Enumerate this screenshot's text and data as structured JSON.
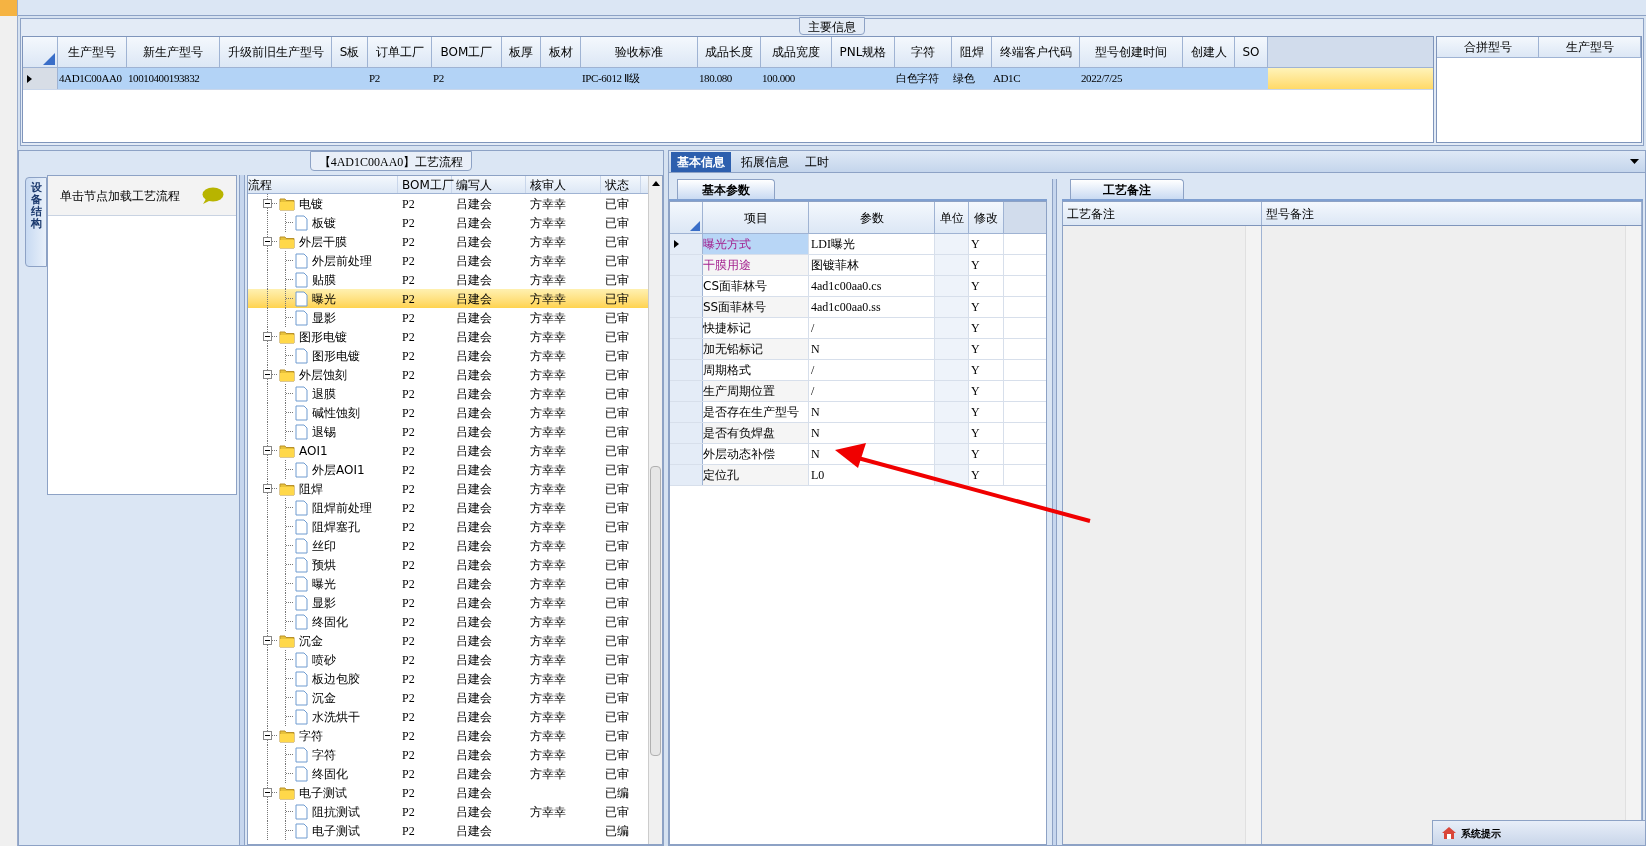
{
  "main_info": {
    "title": "主要信息",
    "columns": [
      "生产型号",
      "新生产型号",
      "升级前旧生产型号",
      "S板",
      "订单工厂",
      "BOM工厂",
      "板厚",
      "板材",
      "验收标准",
      "成品长度",
      "成品宽度",
      "PNL规格",
      "字符",
      "阻焊",
      "终端客户代码",
      "型号创建时间",
      "创建人",
      "SO"
    ],
    "rows": [
      {
        "selected": true,
        "cells": [
          "4AD1C00AA0",
          "10010400193832",
          null,
          null,
          "P2",
          "P2",
          null,
          null,
          "IPC-6012 Ⅱ级",
          "180.080",
          "100.000",
          null,
          "白色字符",
          "绿色",
          "AD1C",
          "2022/7/25",
          null,
          null
        ]
      }
    ]
  },
  "merge_table": {
    "columns": [
      "合拼型号",
      "生产型号"
    ]
  },
  "process_panel": {
    "title": "【4AD1C00AA0】工艺流程",
    "side_tab": "设备结构",
    "hint": "单击节点加载工艺流程",
    "columns": [
      "流程",
      "BOM工厂",
      "编写人",
      "核审人",
      "状态"
    ],
    "tree": [
      {
        "name": "电镀",
        "factory": "P2",
        "writer": "吕建会",
        "reviewer": "方幸幸",
        "status": "已审",
        "selected": false,
        "children": [
          {
            "name": "板镀",
            "factory": "P2",
            "writer": "吕建会",
            "reviewer": "方幸幸",
            "status": "已审",
            "selected": false
          }
        ]
      },
      {
        "name": "外层干膜",
        "factory": "P2",
        "writer": "吕建会",
        "reviewer": "方幸幸",
        "status": "已审",
        "selected": false,
        "children": [
          {
            "name": "外层前处理",
            "factory": "P2",
            "writer": "吕建会",
            "reviewer": "方幸幸",
            "status": "已审",
            "selected": false
          },
          {
            "name": "贴膜",
            "factory": "P2",
            "writer": "吕建会",
            "reviewer": "方幸幸",
            "status": "已审",
            "selected": false
          },
          {
            "name": "曝光",
            "factory": "P2",
            "writer": "吕建会",
            "reviewer": "方幸幸",
            "status": "已审",
            "selected": true
          },
          {
            "name": "显影",
            "factory": "P2",
            "writer": "吕建会",
            "reviewer": "方幸幸",
            "status": "已审",
            "selected": false
          }
        ]
      },
      {
        "name": "图形电镀",
        "factory": "P2",
        "writer": "吕建会",
        "reviewer": "方幸幸",
        "status": "已审",
        "selected": false,
        "children": [
          {
            "name": "图形电镀",
            "factory": "P2",
            "writer": "吕建会",
            "reviewer": "方幸幸",
            "status": "已审",
            "selected": false
          }
        ]
      },
      {
        "name": "外层蚀刻",
        "factory": "P2",
        "writer": "吕建会",
        "reviewer": "方幸幸",
        "status": "已审",
        "selected": false,
        "children": [
          {
            "name": "退膜",
            "factory": "P2",
            "writer": "吕建会",
            "reviewer": "方幸幸",
            "status": "已审",
            "selected": false
          },
          {
            "name": "碱性蚀刻",
            "factory": "P2",
            "writer": "吕建会",
            "reviewer": "方幸幸",
            "status": "已审",
            "selected": false
          },
          {
            "name": "退锡",
            "factory": "P2",
            "writer": "吕建会",
            "reviewer": "方幸幸",
            "status": "已审",
            "selected": false
          }
        ]
      },
      {
        "name": "AOI1",
        "factory": "P2",
        "writer": "吕建会",
        "reviewer": "方幸幸",
        "status": "已审",
        "selected": false,
        "children": [
          {
            "name": "外层AOI1",
            "factory": "P2",
            "writer": "吕建会",
            "reviewer": "方幸幸",
            "status": "已审",
            "selected": false
          }
        ]
      },
      {
        "name": "阻焊",
        "factory": "P2",
        "writer": "吕建会",
        "reviewer": "方幸幸",
        "status": "已审",
        "selected": false,
        "children": [
          {
            "name": "阻焊前处理",
            "factory": "P2",
            "writer": "吕建会",
            "reviewer": "方幸幸",
            "status": "已审",
            "selected": false
          },
          {
            "name": "阻焊塞孔",
            "factory": "P2",
            "writer": "吕建会",
            "reviewer": "方幸幸",
            "status": "已审",
            "selected": false
          },
          {
            "name": "丝印",
            "factory": "P2",
            "writer": "吕建会",
            "reviewer": "方幸幸",
            "status": "已审",
            "selected": false
          },
          {
            "name": "预烘",
            "factory": "P2",
            "writer": "吕建会",
            "reviewer": "方幸幸",
            "status": "已审",
            "selected": false
          },
          {
            "name": "曝光",
            "factory": "P2",
            "writer": "吕建会",
            "reviewer": "方幸幸",
            "status": "已审",
            "selected": false
          },
          {
            "name": "显影",
            "factory": "P2",
            "writer": "吕建会",
            "reviewer": "方幸幸",
            "status": "已审",
            "selected": false
          },
          {
            "name": "终固化",
            "factory": "P2",
            "writer": "吕建会",
            "reviewer": "方幸幸",
            "status": "已审",
            "selected": false
          }
        ]
      },
      {
        "name": "沉金",
        "factory": "P2",
        "writer": "吕建会",
        "reviewer": "方幸幸",
        "status": "已审",
        "selected": false,
        "children": [
          {
            "name": "喷砂",
            "factory": "P2",
            "writer": "吕建会",
            "reviewer": "方幸幸",
            "status": "已审",
            "selected": false
          },
          {
            "name": "板边包胶",
            "factory": "P2",
            "writer": "吕建会",
            "reviewer": "方幸幸",
            "status": "已审",
            "selected": false
          },
          {
            "name": "沉金",
            "factory": "P2",
            "writer": "吕建会",
            "reviewer": "方幸幸",
            "status": "已审",
            "selected": false
          },
          {
            "name": "水洗烘干",
            "factory": "P2",
            "writer": "吕建会",
            "reviewer": "方幸幸",
            "status": "已审",
            "selected": false
          }
        ]
      },
      {
        "name": "字符",
        "factory": "P2",
        "writer": "吕建会",
        "reviewer": "方幸幸",
        "status": "已审",
        "selected": false,
        "children": [
          {
            "name": "字符",
            "factory": "P2",
            "writer": "吕建会",
            "reviewer": "方幸幸",
            "status": "已审",
            "selected": false
          },
          {
            "name": "终固化",
            "factory": "P2",
            "writer": "吕建会",
            "reviewer": "方幸幸",
            "status": "已审",
            "selected": false
          }
        ]
      },
      {
        "name": "电子测试",
        "factory": "P2",
        "writer": "吕建会",
        "status": "已编",
        "selected": false,
        "children": [
          {
            "name": "阻抗测试",
            "factory": "P2",
            "writer": "吕建会",
            "reviewer": "方幸幸",
            "status": "已审",
            "selected": false
          },
          {
            "name": "电子测试",
            "factory": "P2",
            "writer": "吕建会",
            "status": "已编",
            "selected": false
          }
        ]
      }
    ]
  },
  "detail_tabs": [
    {
      "label": "基本信息",
      "selected": true
    },
    {
      "label": "拓展信息",
      "selected": false
    },
    {
      "label": "工时",
      "selected": false
    }
  ],
  "params": {
    "tab": "基本参数",
    "columns": [
      "项目",
      "参数",
      "单位",
      "修改"
    ],
    "rows": [
      {
        "item": "曝光方式",
        "value": "LDI曝光",
        "modify": "Y",
        "highlighted": true,
        "selected": true
      },
      {
        "item": "干膜用途",
        "value": "图镀菲林",
        "modify": "Y",
        "highlighted": true,
        "selected": false
      },
      {
        "item": "CS面菲林号",
        "value": "4ad1c00aa0.cs",
        "modify": "Y",
        "highlighted": false,
        "selected": false
      },
      {
        "item": "SS面菲林号",
        "value": "4ad1c00aa0.ss",
        "modify": "Y",
        "highlighted": false,
        "selected": false
      },
      {
        "item": "快捷标记",
        "value": "/",
        "modify": "Y",
        "highlighted": false,
        "selected": false
      },
      {
        "item": "加无铅标记",
        "value": "N",
        "modify": "Y",
        "highlighted": false,
        "selected": false
      },
      {
        "item": "周期格式",
        "value": "/",
        "modify": "Y",
        "highlighted": false,
        "selected": false
      },
      {
        "item": "生产周期位置",
        "value": "/",
        "modify": "Y",
        "highlighted": false,
        "selected": false
      },
      {
        "item": "是否存在生产型号",
        "value": "N",
        "modify": "Y",
        "highlighted": false,
        "selected": false
      },
      {
        "item": "是否有负焊盘",
        "value": "N",
        "modify": "Y",
        "highlighted": false,
        "selected": false
      },
      {
        "item": "外层动态补偿",
        "value": "N",
        "modify": "Y",
        "highlighted": false,
        "selected": false
      },
      {
        "item": "定位孔",
        "value": "L0",
        "modify": "Y",
        "highlighted": false,
        "selected": false
      }
    ]
  },
  "notes": {
    "tab": "工艺备注",
    "columns": [
      "工艺备注",
      "型号备注"
    ]
  },
  "notification": {
    "title": "系统提示"
  }
}
